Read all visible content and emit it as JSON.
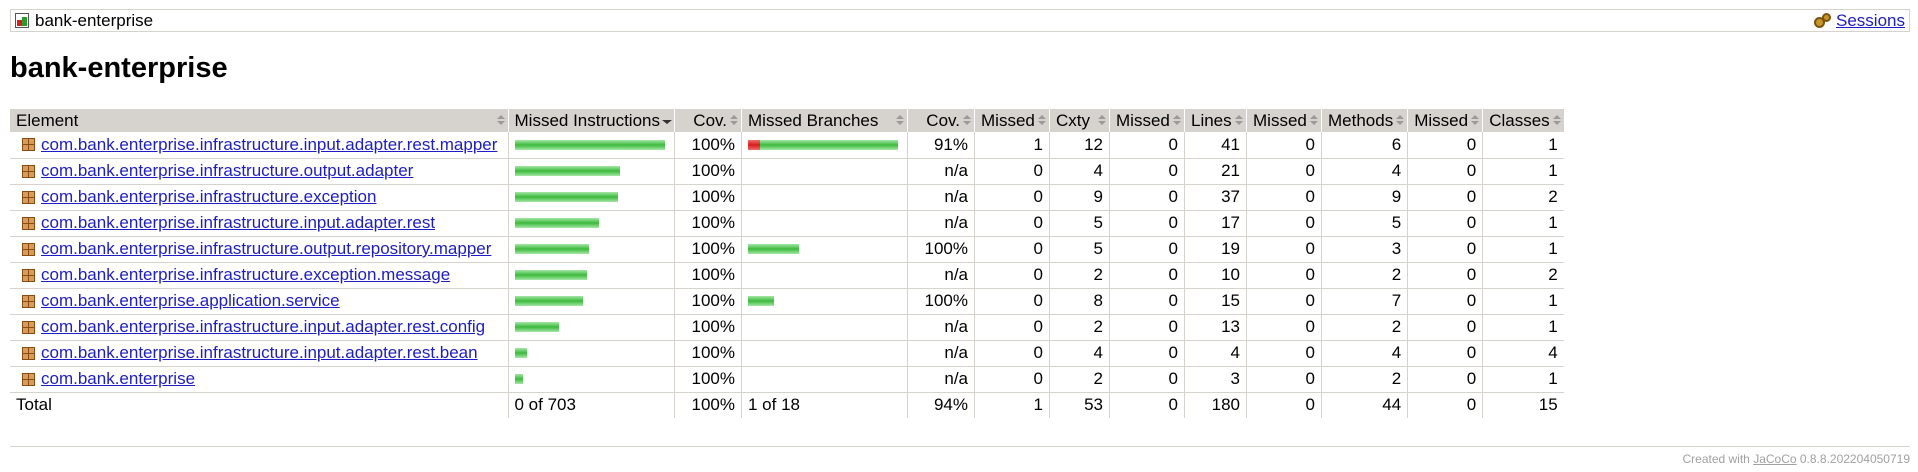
{
  "breadcrumb": {
    "report_name": "bank-enterprise",
    "sessions_label": "Sessions"
  },
  "page_title": "bank-enterprise",
  "columns": [
    {
      "label": "Element",
      "sorted": false
    },
    {
      "label": "Missed Instructions",
      "sorted": true
    },
    {
      "label": "Cov.",
      "sorted": false
    },
    {
      "label": "Missed Branches",
      "sorted": false
    },
    {
      "label": "Cov.",
      "sorted": false
    },
    {
      "label": "Missed",
      "sorted": false
    },
    {
      "label": "Cxty",
      "sorted": false
    },
    {
      "label": "Missed",
      "sorted": false
    },
    {
      "label": "Lines",
      "sorted": false
    },
    {
      "label": "Missed",
      "sorted": false
    },
    {
      "label": "Methods",
      "sorted": false
    },
    {
      "label": "Missed",
      "sorted": false
    },
    {
      "label": "Classes",
      "sorted": false
    }
  ],
  "rows": [
    {
      "element": "com.bank.enterprise.infrastructure.input.adapter.rest.mapper",
      "instr_missed_fraction": 0.0,
      "instr_covered_relative": 1.0,
      "instr_cov": "100%",
      "branch_missed_relative": 0.08,
      "branch_covered_relative": 0.92,
      "branch_cov": "91%",
      "cxty_missed": "1",
      "cxty": "12",
      "lines_missed": "0",
      "lines": "41",
      "methods_missed": "0",
      "methods": "6",
      "classes_missed": "0",
      "classes": "1"
    },
    {
      "element": "com.bank.enterprise.infrastructure.output.adapter",
      "instr_missed_fraction": 0.0,
      "instr_covered_relative": 0.7,
      "instr_cov": "100%",
      "branch_missed_relative": 0,
      "branch_covered_relative": 0,
      "branch_cov": "n/a",
      "cxty_missed": "0",
      "cxty": "4",
      "lines_missed": "0",
      "lines": "21",
      "methods_missed": "0",
      "methods": "4",
      "classes_missed": "0",
      "classes": "1"
    },
    {
      "element": "com.bank.enterprise.infrastructure.exception",
      "instr_missed_fraction": 0.0,
      "instr_covered_relative": 0.69,
      "instr_cov": "100%",
      "branch_missed_relative": 0,
      "branch_covered_relative": 0,
      "branch_cov": "n/a",
      "cxty_missed": "0",
      "cxty": "9",
      "lines_missed": "0",
      "lines": "37",
      "methods_missed": "0",
      "methods": "9",
      "classes_missed": "0",
      "classes": "2"
    },
    {
      "element": "com.bank.enterprise.infrastructure.input.adapter.rest",
      "instr_missed_fraction": 0.0,
      "instr_covered_relative": 0.56,
      "instr_cov": "100%",
      "branch_missed_relative": 0,
      "branch_covered_relative": 0,
      "branch_cov": "n/a",
      "cxty_missed": "0",
      "cxty": "5",
      "lines_missed": "0",
      "lines": "17",
      "methods_missed": "0",
      "methods": "5",
      "classes_missed": "0",
      "classes": "1"
    },
    {
      "element": "com.bank.enterprise.infrastructure.output.repository.mapper",
      "instr_missed_fraction": 0.0,
      "instr_covered_relative": 0.49,
      "instr_cov": "100%",
      "branch_missed_relative": 0,
      "branch_covered_relative": 0.34,
      "branch_cov": "100%",
      "cxty_missed": "0",
      "cxty": "5",
      "lines_missed": "0",
      "lines": "19",
      "methods_missed": "0",
      "methods": "3",
      "classes_missed": "0",
      "classes": "1"
    },
    {
      "element": "com.bank.enterprise.infrastructure.exception.message",
      "instr_missed_fraction": 0.0,
      "instr_covered_relative": 0.48,
      "instr_cov": "100%",
      "branch_missed_relative": 0,
      "branch_covered_relative": 0,
      "branch_cov": "n/a",
      "cxty_missed": "0",
      "cxty": "2",
      "lines_missed": "0",
      "lines": "10",
      "methods_missed": "0",
      "methods": "2",
      "classes_missed": "0",
      "classes": "2"
    },
    {
      "element": "com.bank.enterprise.application.service",
      "instr_missed_fraction": 0.0,
      "instr_covered_relative": 0.45,
      "instr_cov": "100%",
      "branch_missed_relative": 0,
      "branch_covered_relative": 0.17,
      "branch_cov": "100%",
      "cxty_missed": "0",
      "cxty": "8",
      "lines_missed": "0",
      "lines": "15",
      "methods_missed": "0",
      "methods": "7",
      "classes_missed": "0",
      "classes": "1"
    },
    {
      "element": "com.bank.enterprise.infrastructure.input.adapter.rest.config",
      "instr_missed_fraction": 0.0,
      "instr_covered_relative": 0.29,
      "instr_cov": "100%",
      "branch_missed_relative": 0,
      "branch_covered_relative": 0,
      "branch_cov": "n/a",
      "cxty_missed": "0",
      "cxty": "2",
      "lines_missed": "0",
      "lines": "13",
      "methods_missed": "0",
      "methods": "2",
      "classes_missed": "0",
      "classes": "1"
    },
    {
      "element": "com.bank.enterprise.infrastructure.input.adapter.rest.bean",
      "instr_missed_fraction": 0.0,
      "instr_covered_relative": 0.08,
      "instr_cov": "100%",
      "branch_missed_relative": 0,
      "branch_covered_relative": 0,
      "branch_cov": "n/a",
      "cxty_missed": "0",
      "cxty": "4",
      "lines_missed": "0",
      "lines": "4",
      "methods_missed": "0",
      "methods": "4",
      "classes_missed": "0",
      "classes": "4"
    },
    {
      "element": "com.bank.enterprise",
      "instr_missed_fraction": 0.0,
      "instr_covered_relative": 0.05,
      "instr_cov": "100%",
      "branch_missed_relative": 0,
      "branch_covered_relative": 0,
      "branch_cov": "n/a",
      "cxty_missed": "0",
      "cxty": "2",
      "lines_missed": "0",
      "lines": "3",
      "methods_missed": "0",
      "methods": "2",
      "classes_missed": "0",
      "classes": "1"
    }
  ],
  "total": {
    "label": "Total",
    "instr": "0 of 703",
    "instr_cov": "100%",
    "branch": "1 of 18",
    "branch_cov": "94%",
    "cxty_missed": "1",
    "cxty": "53",
    "lines_missed": "0",
    "lines": "180",
    "methods_missed": "0",
    "methods": "44",
    "classes_missed": "0",
    "classes": "15"
  },
  "footer": {
    "prefix": "Created with ",
    "link": "JaCoCo",
    "version": " 0.8.8.202204050719"
  },
  "colors": {
    "header_bg": "#d6d3ce",
    "link": "#1d1dc4",
    "bar_green": "#3cba3c",
    "bar_red": "#d41c1c"
  }
}
